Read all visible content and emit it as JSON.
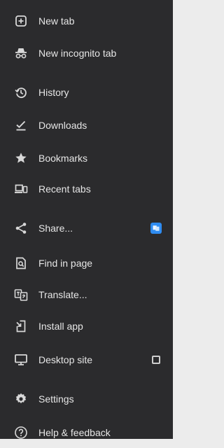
{
  "menu": {
    "items": [
      {
        "label": "New tab",
        "icon": "new-tab-icon"
      },
      {
        "label": "New incognito tab",
        "icon": "incognito-icon"
      },
      {
        "label": "History",
        "icon": "history-icon"
      },
      {
        "label": "Downloads",
        "icon": "download-icon"
      },
      {
        "label": "Bookmarks",
        "icon": "star-icon"
      },
      {
        "label": "Recent tabs",
        "icon": "recent-tabs-icon"
      },
      {
        "label": "Share...",
        "icon": "share-icon",
        "trailing": "share-target-app-icon"
      },
      {
        "label": "Find in page",
        "icon": "find-in-page-icon"
      },
      {
        "label": "Translate...",
        "icon": "translate-icon"
      },
      {
        "label": "Install app",
        "icon": "install-app-icon"
      },
      {
        "label": "Desktop site",
        "icon": "desktop-icon",
        "checked": false
      },
      {
        "label": "Settings",
        "icon": "settings-icon"
      },
      {
        "label": "Help & feedback",
        "icon": "help-icon"
      }
    ]
  },
  "colors": {
    "menu_background": "#2b2b2d",
    "text": "#e6e6e6",
    "share_tile": "#2f8cf1"
  }
}
